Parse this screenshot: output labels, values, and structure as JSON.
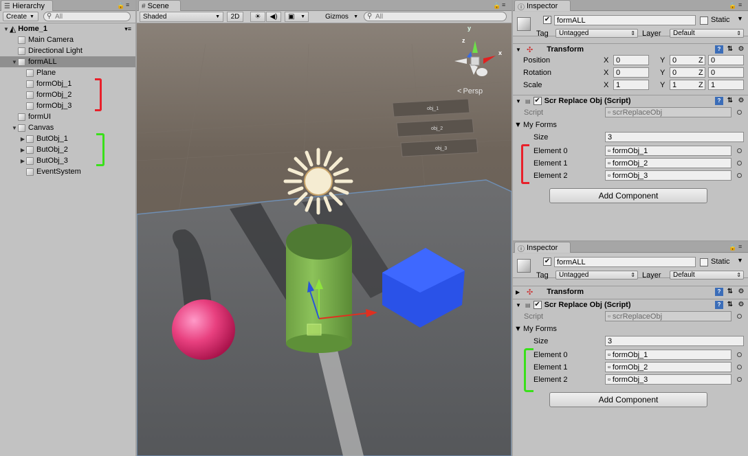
{
  "hierarchy": {
    "tab_label": "Hierarchy",
    "create_label": "Create",
    "search_placeholder": "All",
    "scene_name": "Home_1",
    "items": [
      {
        "label": "Main Camera",
        "depth": 1,
        "expander": ""
      },
      {
        "label": "Directional Light",
        "depth": 1,
        "expander": ""
      },
      {
        "label": "formALL",
        "depth": 1,
        "expander": "▼",
        "selected": true
      },
      {
        "label": "Plane",
        "depth": 2,
        "expander": ""
      },
      {
        "label": "formObj_1",
        "depth": 2,
        "expander": ""
      },
      {
        "label": "formObj_2",
        "depth": 2,
        "expander": ""
      },
      {
        "label": "formObj_3",
        "depth": 2,
        "expander": ""
      },
      {
        "label": "formUI",
        "depth": 1,
        "expander": ""
      },
      {
        "label": "Canvas",
        "depth": 1,
        "expander": "▼"
      },
      {
        "label": "ButObj_1",
        "depth": 2,
        "expander": "▶"
      },
      {
        "label": "ButObj_2",
        "depth": 2,
        "expander": "▶"
      },
      {
        "label": "ButObj_3",
        "depth": 2,
        "expander": "▶"
      },
      {
        "label": "EventSystem",
        "depth": 2,
        "expander": ""
      }
    ]
  },
  "scene": {
    "tab_label": "Scene",
    "shading_mode": "Shaded",
    "mode_2d": "2D",
    "gizmos_label": "Gizmos",
    "search_placeholder": "All",
    "persp_label": "Persp",
    "gizmo_axes": {
      "y": "y",
      "z": "z",
      "x": "x"
    },
    "ui_panels": [
      "obj_1",
      "obj_2",
      "obj_3"
    ]
  },
  "inspectors": [
    {
      "tab_label": "Inspector",
      "object_name": "formALL",
      "active": true,
      "static_label": "Static",
      "tag_label": "Tag",
      "tag_value": "Untagged",
      "layer_label": "Layer",
      "layer_value": "Default",
      "transform": {
        "title": "Transform",
        "rows": [
          {
            "label": "Position",
            "x": "0",
            "y": "0",
            "z": "0"
          },
          {
            "label": "Rotation",
            "x": "0",
            "y": "0",
            "z": "0"
          },
          {
            "label": "Scale",
            "x": "1",
            "y": "1",
            "z": "1"
          }
        ]
      },
      "script_component": {
        "title": "Scr Replace Obj (Script)",
        "script_label": "Script",
        "script_value": "scrReplaceObj",
        "list_label": "My Forms",
        "size_label": "Size",
        "size_value": "3",
        "elements": [
          {
            "label": "Element 0",
            "value": "formObj_1"
          },
          {
            "label": "Element 1",
            "value": "formObj_2"
          },
          {
            "label": "Element 2",
            "value": "formObj_3"
          }
        ]
      },
      "add_component_label": "Add Component",
      "bracket_color": "#e8202a"
    },
    {
      "tab_label": "Inspector",
      "object_name": "formALL",
      "active": true,
      "static_label": "Static",
      "tag_label": "Tag",
      "tag_value": "Untagged",
      "layer_label": "Layer",
      "layer_value": "Default",
      "transform": {
        "title": "Transform"
      },
      "script_component": {
        "title": "Scr Replace Obj (Script)",
        "script_label": "Script",
        "script_value": "scrReplaceObj",
        "list_label": "My Forms",
        "size_label": "Size",
        "size_value": "3",
        "elements": [
          {
            "label": "Element 0",
            "value": "formObj_1"
          },
          {
            "label": "Element 1",
            "value": "formObj_2"
          },
          {
            "label": "Element 2",
            "value": "formObj_3"
          }
        ]
      },
      "add_component_label": "Add Component",
      "bracket_color": "#39e01a"
    }
  ],
  "annotations": {
    "red": "#e8202a",
    "green": "#39e01a"
  }
}
